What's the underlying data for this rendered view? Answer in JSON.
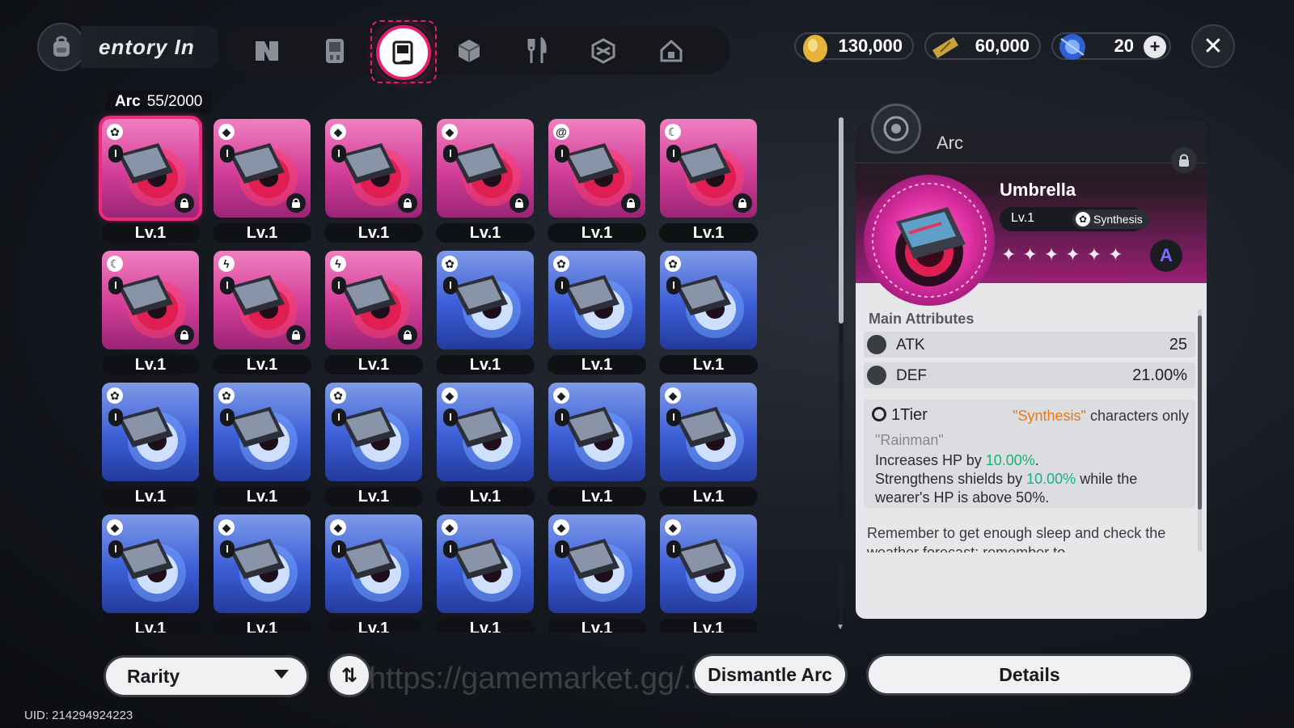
{
  "header": {
    "title_tab": "entory  In",
    "tabs": [
      "tab-nikke",
      "tab-gear",
      "tab-arc",
      "tab-box",
      "tab-food",
      "tab-material",
      "tab-home"
    ],
    "active_tab": "tab-arc"
  },
  "currencies": [
    {
      "name": "gold",
      "value": "130,000",
      "icon": "gold-coin-icon",
      "color": "#e6b43a"
    },
    {
      "name": "ticket",
      "value": "60,000",
      "icon": "ticket-icon",
      "color": "#c9a43a"
    },
    {
      "name": "gem",
      "value": "20",
      "icon": "gem-icon",
      "color": "#3a78e6"
    }
  ],
  "plus_label": "+",
  "close_label": "✕",
  "inventory": {
    "label": "Arc",
    "count": "55/2000",
    "level_label": "Lv.1",
    "rows": [
      [
        {
          "color": "pink",
          "element": "gear",
          "locked": true,
          "selected": true
        },
        {
          "color": "pink",
          "element": "dice",
          "locked": true
        },
        {
          "color": "pink",
          "element": "dice",
          "locked": true
        },
        {
          "color": "pink",
          "element": "dice",
          "locked": true
        },
        {
          "color": "pink",
          "element": "swirl",
          "locked": true
        },
        {
          "color": "pink",
          "element": "moon",
          "locked": true
        }
      ],
      [
        {
          "color": "pink",
          "element": "moon",
          "locked": true
        },
        {
          "color": "pink",
          "element": "bolt",
          "locked": true
        },
        {
          "color": "pink",
          "element": "bolt",
          "locked": true
        },
        {
          "color": "blue",
          "element": "gear",
          "locked": false
        },
        {
          "color": "blue",
          "element": "gear",
          "locked": false
        },
        {
          "color": "blue",
          "element": "gear",
          "locked": false
        }
      ],
      [
        {
          "color": "blue",
          "element": "gear",
          "locked": false
        },
        {
          "color": "blue",
          "element": "gear",
          "locked": false
        },
        {
          "color": "blue",
          "element": "gear",
          "locked": false
        },
        {
          "color": "blue",
          "element": "dice",
          "locked": false
        },
        {
          "color": "blue",
          "element": "dice",
          "locked": false
        },
        {
          "color": "blue",
          "element": "dice",
          "locked": false
        }
      ],
      [
        {
          "color": "blue",
          "element": "dice",
          "locked": false
        },
        {
          "color": "blue",
          "element": "dice",
          "locked": false
        },
        {
          "color": "blue",
          "element": "dice",
          "locked": false
        },
        {
          "color": "blue",
          "element": "dice",
          "locked": false
        },
        {
          "color": "blue",
          "element": "dice",
          "locked": false
        },
        {
          "color": "blue",
          "element": "dice",
          "locked": false
        }
      ]
    ],
    "tier_label": "I"
  },
  "detail": {
    "category": "Arc",
    "name": "Umbrella",
    "level": "Lv.1",
    "type": "Synthesis",
    "stars": "✦✦✦✦✦✦",
    "rank": "A",
    "main_attributes_title": "Main Attributes",
    "attributes": [
      {
        "name": "ATK",
        "value": "25"
      },
      {
        "name": "DEF",
        "value": "21.00%"
      }
    ],
    "tier": "1Tier",
    "restriction_highlight": "\"Synthesis\"",
    "restriction_rest": " characters only",
    "effect_name": "\"Rainman\"",
    "effect_line1_pre": "Increases HP by ",
    "effect_line1_val": "10.00%",
    "effect_line1_post": ".",
    "effect_line2_pre": "Strengthens shields by ",
    "effect_line2_val": "10.00%",
    "effect_line2_post": " while the wearer's HP is above 50%.",
    "flavor": "Remember to get enough sleep and check the weather forecast; remember to"
  },
  "bottom": {
    "rarity_label": "Rarity",
    "sort_label": "⇅",
    "watermark": "https://gamemarket.gg/...ng.lohn",
    "dismantle_label": "Dismantle Arc",
    "details_label": "Details",
    "uid": "UID: 214294924223"
  },
  "colors": {
    "accent": "#e6206d",
    "effect_highlight": "#16b37a",
    "restriction": "#e77a17"
  }
}
